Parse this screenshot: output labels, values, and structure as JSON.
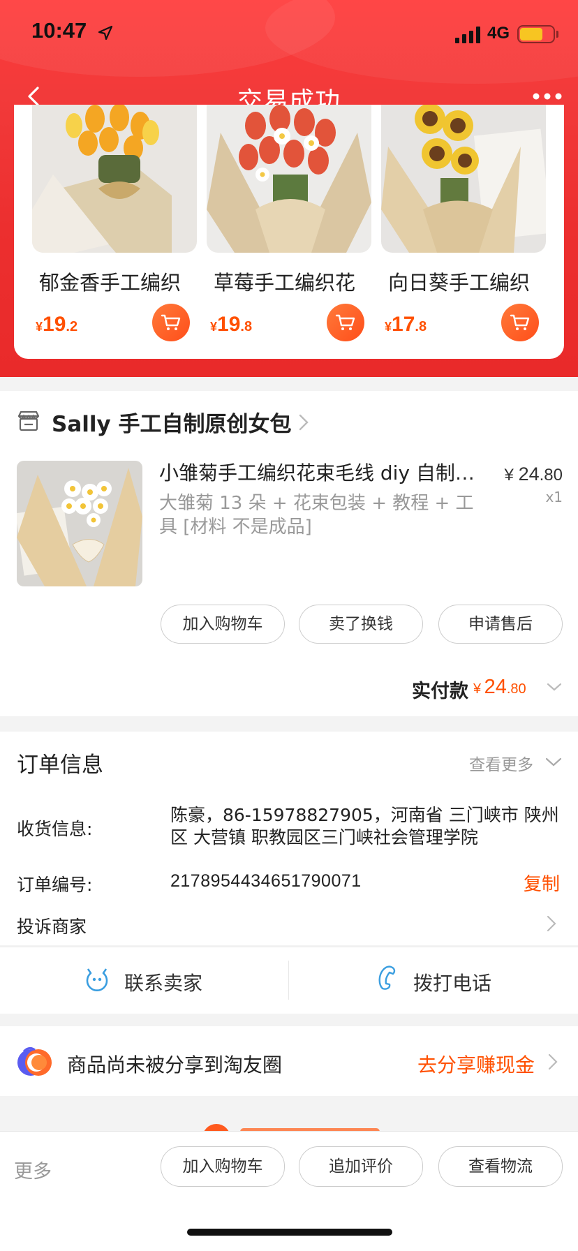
{
  "status_bar": {
    "time": "10:47",
    "network": "4G"
  },
  "nav": {
    "title": "交易成功"
  },
  "recommendations": [
    {
      "name": "郁金香手工编织",
      "price_currency": "¥",
      "price_int": "19",
      "price_dec": ".2"
    },
    {
      "name": "草莓手工编织花",
      "price_currency": "¥",
      "price_int": "19",
      "price_dec": ".8"
    },
    {
      "name": "向日葵手工编织",
      "price_currency": "¥",
      "price_int": "17",
      "price_dec": ".8"
    }
  ],
  "shop": {
    "name": "Sally 手工自制原创女包"
  },
  "item": {
    "title": "小雏菊手工编织花束毛线 diy 自制…",
    "desc": "大雏菊 13 朵 + 花束包装 + 教程 + 工具 [材料 不是成品]",
    "price_currency": "¥",
    "price_int": "24",
    "price_dec": ".80",
    "qty": "x1",
    "buttons": [
      "加入购物车",
      "卖了换钱",
      "申请售后"
    ]
  },
  "payment": {
    "label": "实付款",
    "currency": "¥",
    "int": "24",
    "dec": ".80"
  },
  "order": {
    "title": "订单信息",
    "more": "查看更多",
    "address_label": "收货信息:",
    "address": "陈豪，86-15978827905，河南省 三门峡市 陕州区 大营镇 职教园区三门峡社会管理学院",
    "order_no_label": "订单编号:",
    "order_no": "2178954434651790071",
    "copy": "复制",
    "complain": "投诉商家"
  },
  "contact": {
    "seller": "联系卖家",
    "phone": "拨打电话"
  },
  "share": {
    "text": "商品尚未被分享到淘友圈",
    "cta": "去分享赚现金"
  },
  "bottom": {
    "more": "更多",
    "buttons": [
      "加入购物车",
      "追加评价",
      "查看物流"
    ]
  },
  "colors": {
    "accent": "#ff5000",
    "header_red": "#ec2f2f",
    "link_blue": "#3a9ee0"
  }
}
